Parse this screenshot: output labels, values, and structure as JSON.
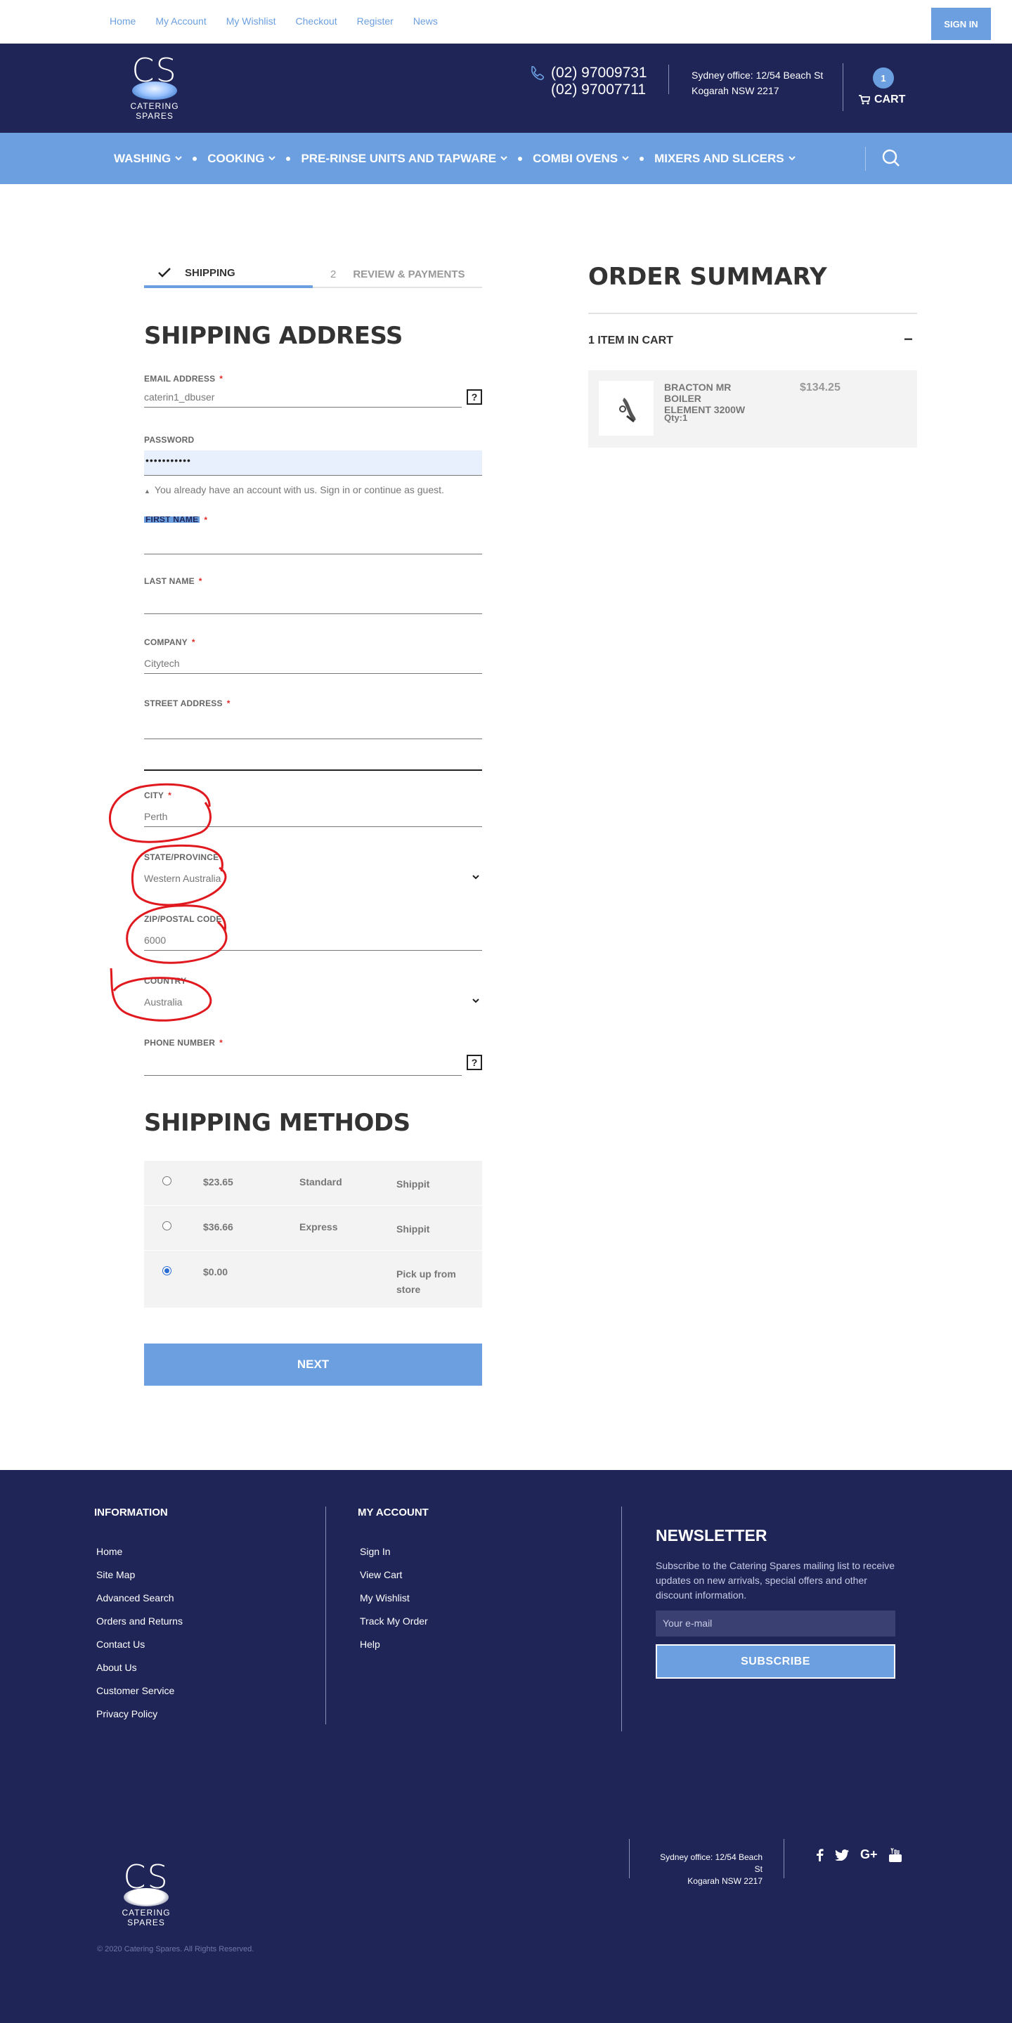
{
  "topbar": {
    "links": [
      "Home",
      "My Account",
      "My Wishlist",
      "Checkout",
      "Register",
      "News"
    ],
    "sign_in": "SIGN IN"
  },
  "header": {
    "logo_mark": "CS",
    "logo_text": "CATERING SPARES",
    "phone1": "(02) 97009731",
    "phone2": "(02) 97007711",
    "office_line1": "Sydney office: 12/54 Beach St",
    "office_line2": "Kogarah NSW 2217",
    "cart_count": "1",
    "cart_label": "CART"
  },
  "nav": {
    "items": [
      "WASHING",
      "COOKING",
      "PRE-RINSE UNITS AND TAPWARE",
      "COMBI OVENS",
      "MIXERS AND SLICERS"
    ]
  },
  "steps": {
    "step1_label": "SHIPPING",
    "step2_num": "2",
    "step2_label": "REVIEW & PAYMENTS"
  },
  "shipping_address": {
    "title": "SHIPPING ADDRESS",
    "email_label": "EMAIL ADDRESS",
    "email_value": "caterin1_dbuser",
    "password_label": "PASSWORD",
    "password_value": "•••••••••••",
    "password_note": "You already have an account with us. Sign in or continue as guest.",
    "first_name_label": "FIRST NAME",
    "first_name_value": "",
    "last_name_label": "LAST NAME",
    "last_name_value": "",
    "company_label": "COMPANY",
    "company_value": "Citytech",
    "street_label": "STREET ADDRESS",
    "street_value1": "",
    "street_value2": "",
    "city_label": "CITY",
    "city_value": "Perth",
    "state_label": "STATE/PROVINCE",
    "state_value": "Western Australia",
    "zip_label": "ZIP/POSTAL CODE",
    "zip_value": "6000",
    "country_label": "COUNTRY",
    "country_value": "Australia",
    "phone_label": "PHONE NUMBER",
    "phone_value": "",
    "help_symbol": "?",
    "required_mark": "*"
  },
  "shipping_methods": {
    "title": "SHIPPING METHODS",
    "rows": [
      {
        "price": "$23.65",
        "title": "Standard",
        "carrier": "Shippit",
        "selected": false
      },
      {
        "price": "$36.66",
        "title": "Express",
        "carrier": "Shippit",
        "selected": false
      },
      {
        "price": "$0.00",
        "title": "",
        "carrier": "Pick up from store",
        "selected": true
      }
    ],
    "next_label": "NEXT"
  },
  "order_summary": {
    "title": "ORDER SUMMARY",
    "count_label": "1 ITEM IN CART",
    "toggle": "−",
    "item_name": "BRACTON MR BOILER ELEMENT 3200W",
    "item_price": "$134.25",
    "item_qty": "Qty:1"
  },
  "footer": {
    "information_title": "INFORMATION",
    "information_links": [
      "Home",
      "Site Map",
      "Advanced Search",
      "Orders and Returns",
      "Contact Us",
      "About Us",
      "Customer Service",
      "Privacy Policy"
    ],
    "account_title": "MY ACCOUNT",
    "account_links": [
      "Sign In",
      "View Cart",
      "My Wishlist",
      "Track My Order",
      "Help"
    ],
    "newsletter_title": "NEWSLETTER",
    "newsletter_text": "Subscribe to the Catering Spares mailing list to receive updates on new arrivals, special offers and other discount information.",
    "newsletter_placeholder": "Your e-mail",
    "subscribe_label": "SUBSCRIBE",
    "office_line1": "Sydney office: 12/54 Beach St",
    "office_line2": "Kogarah NSW 2217",
    "social": [
      "f",
      "t",
      "G+",
      "yt"
    ],
    "copyright": "© 2020 Catering Spares. All Rights Reserved."
  },
  "colors": {
    "navy": "#1f2557",
    "accent": "#6b9fe0",
    "required": "#e02b27",
    "annotation": "#e0191f"
  }
}
